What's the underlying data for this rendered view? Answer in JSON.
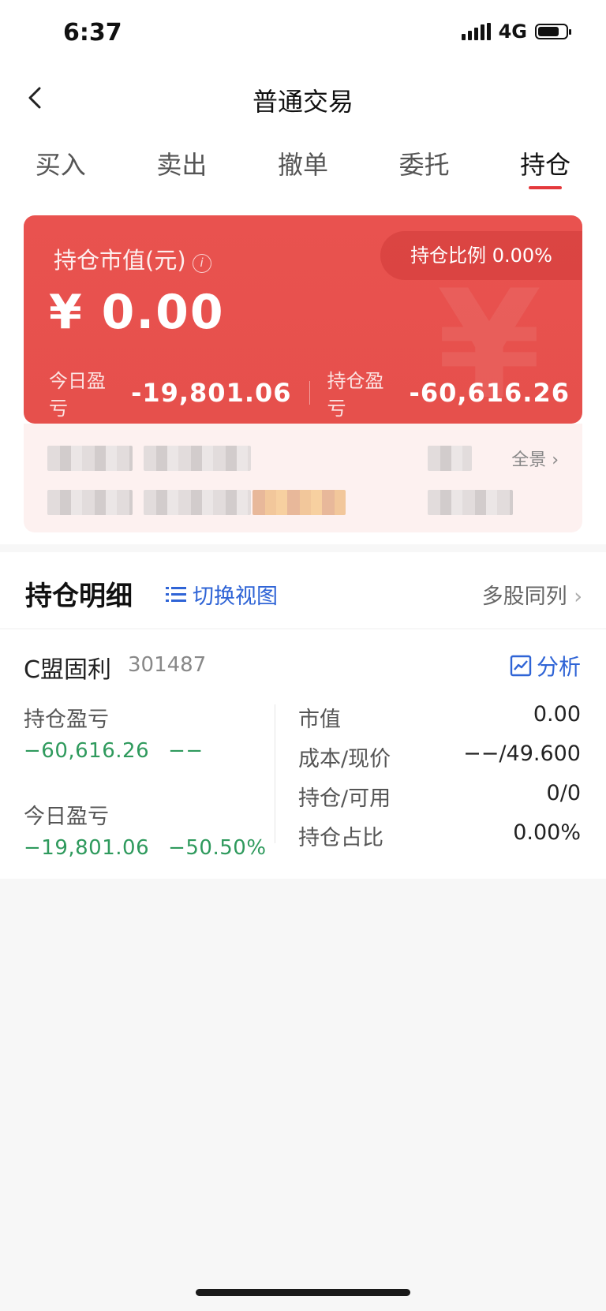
{
  "status": {
    "time": "6:37",
    "network": "4G",
    "battery_level": 0.75
  },
  "nav": {
    "title": "普通交易"
  },
  "tabs": [
    {
      "label": "买入",
      "active": false
    },
    {
      "label": "卖出",
      "active": false
    },
    {
      "label": "撤单",
      "active": false
    },
    {
      "label": "委托",
      "active": false
    },
    {
      "label": "持仓",
      "active": true
    }
  ],
  "summary": {
    "market_value_label": "持仓市值(元)",
    "market_value": "¥ 0.00",
    "ratio_label": "持仓比例 0.00%",
    "today_pl_label": "今日盈亏",
    "today_pl_value": "-19,801.06",
    "hold_pl_label": "持仓盈亏",
    "hold_pl_value": "-60,616.26",
    "watermark": "¥"
  },
  "account": {
    "full_view_label": "全景"
  },
  "detail": {
    "title": "持仓明细",
    "switch_view": "切换视图",
    "multi_stock": "多股同列"
  },
  "holding": {
    "name": "C盟固利",
    "code": "301487",
    "analyze": "分析",
    "hold_pl_label": "持仓盈亏",
    "hold_pl_value": "−60,616.26",
    "hold_pl_pct": "−−",
    "today_pl_label": "今日盈亏",
    "today_pl_value": "−19,801.06",
    "today_pl_pct": "−50.50%",
    "market_value_label": "市值",
    "market_value": "0.00",
    "cost_label": "成本/现价",
    "cost_value": "−−/49.600",
    "qty_label": "持仓/可用",
    "qty_value": "0/0",
    "share_label": "持仓占比",
    "share_value": "0.00%"
  },
  "colors": {
    "accent_red": "#e4393c",
    "link_blue": "#2f64d6",
    "loss_green": "#2f9a5d"
  }
}
